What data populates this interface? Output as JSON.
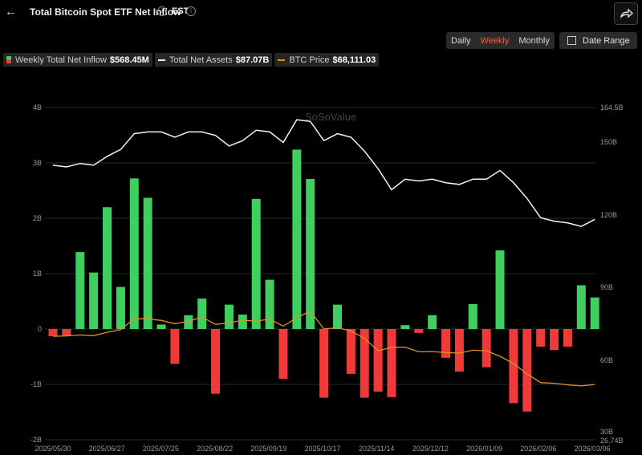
{
  "header": {
    "back_icon": "arrow-left-icon",
    "title": "Total Bitcoin Spot ETF Net Inflow",
    "timezone": "EST",
    "share_icon": "share-icon"
  },
  "controls": {
    "daily": "Daily",
    "weekly": "Weekly",
    "monthly": "Monthly",
    "active": "weekly",
    "date_range": "Date Range"
  },
  "legend": {
    "inflow_label": "Weekly Total Net Inflow",
    "inflow_value": "$568.45M",
    "assets_label": "Total Net Assets",
    "assets_value": "$87.07B",
    "price_label": "BTC Price",
    "price_value": "$68,111.03"
  },
  "watermark": "SoSoValue",
  "colors": {
    "positive": "#3ecf5e",
    "negative": "#f03a3a",
    "assets_line": "#f2f2f2",
    "price_line": "#e0912a",
    "active_tab": "#ff5a3c"
  },
  "chart_data": {
    "type": "bar",
    "x_tick_labels": [
      "2025/05/30",
      "2025/06/27",
      "2025/07/25",
      "2025/08/22",
      "2025/09/19",
      "2025/10/17",
      "2025/11/14",
      "2025/12/12",
      "2026/01/09",
      "2026/02/06",
      "2026/03/06"
    ],
    "left_axis": {
      "ticks": [
        4,
        3,
        2,
        1,
        0,
        -1,
        -2
      ],
      "tick_labels": [
        "4B",
        "3B",
        "2B",
        "1B",
        "0",
        "-1B",
        "-2B"
      ],
      "ylim": [
        -2,
        4
      ]
    },
    "right_axis": {
      "tick_labels": [
        "164.5B",
        "150B",
        "120B",
        "90B",
        "60B",
        "30B",
        "26.74B"
      ],
      "ylim": [
        26.74,
        164.5
      ]
    },
    "series": [
      {
        "name": "Weekly Total Net Inflow",
        "unit": "B USD",
        "values": [
          -0.13,
          -0.12,
          1.39,
          1.02,
          2.2,
          0.76,
          2.72,
          2.37,
          0.08,
          -0.63,
          0.25,
          0.55,
          -1.17,
          0.44,
          0.26,
          2.35,
          0.89,
          -0.9,
          3.24,
          2.71,
          -1.24,
          0.44,
          -0.81,
          -1.24,
          -1.13,
          -1.23,
          0.07,
          -0.07,
          0.25,
          -0.52,
          -0.77,
          0.45,
          -0.69,
          1.42,
          -1.34,
          -1.49,
          -0.32,
          -0.38,
          -0.32,
          0.79,
          0.57
        ]
      },
      {
        "name": "Total Net Assets",
        "unit": "B USD",
        "values": [
          132,
          131,
          133,
          132,
          137,
          141,
          150,
          151,
          151,
          148,
          151,
          151,
          149,
          143,
          146,
          152,
          151,
          145,
          158,
          157,
          146,
          150,
          148,
          140,
          130,
          118,
          124,
          123,
          124,
          122,
          121,
          124,
          124,
          129,
          122,
          113,
          102,
          100,
          99,
          97,
          101
        ]
      },
      {
        "name": "BTC Price",
        "unit": "USD",
        "values": [
          104500,
          104800,
          105500,
          105000,
          107500,
          109500,
          117800,
          117700,
          116500,
          114000,
          115800,
          119000,
          113500,
          114500,
          116800,
          115800,
          117600,
          112200,
          118500,
          123500,
          110000,
          111000,
          108500,
          103000,
          93500,
          96200,
          96300,
          92800,
          93000,
          92200,
          91800,
          94000,
          93600,
          89400,
          84000,
          76000,
          69500,
          69000,
          67800,
          67000,
          68111
        ]
      }
    ]
  }
}
